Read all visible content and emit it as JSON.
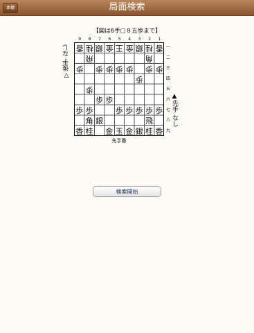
{
  "navbar": {
    "title": "局面検索",
    "back_label": "本棚"
  },
  "board_caption": "【図は6手▢８五歩まで】",
  "file_labels": [
    "9",
    "8",
    "7",
    "6",
    "5",
    "4",
    "3",
    "2",
    "1"
  ],
  "rank_labels": [
    "一",
    "二",
    "三",
    "四",
    "五",
    "六",
    "七",
    "八",
    "九"
  ],
  "gote_hand": "▽後手 なし",
  "sente_hand": "▲先手 なし",
  "turn_label": "先手番",
  "search_button": "検索開始",
  "board": {
    "gote_pieces": [
      {
        "piece": "香",
        "file": 9,
        "rank": 1
      },
      {
        "piece": "桂",
        "file": 8,
        "rank": 1
      },
      {
        "piece": "銀",
        "file": 7,
        "rank": 1
      },
      {
        "piece": "金",
        "file": 6,
        "rank": 1
      },
      {
        "piece": "王",
        "file": 5,
        "rank": 1
      },
      {
        "piece": "金",
        "file": 4,
        "rank": 1
      },
      {
        "piece": "銀",
        "file": 3,
        "rank": 1
      },
      {
        "piece": "桂",
        "file": 2,
        "rank": 1
      },
      {
        "piece": "香",
        "file": 1,
        "rank": 1
      },
      {
        "piece": "飛",
        "file": 8,
        "rank": 2
      },
      {
        "piece": "角",
        "file": 2,
        "rank": 2
      },
      {
        "piece": "歩",
        "file": 9,
        "rank": 3
      },
      {
        "piece": "歩",
        "file": 7,
        "rank": 3
      },
      {
        "piece": "歩",
        "file": 6,
        "rank": 3
      },
      {
        "piece": "歩",
        "file": 5,
        "rank": 3
      },
      {
        "piece": "歩",
        "file": 4,
        "rank": 3
      },
      {
        "piece": "歩",
        "file": 2,
        "rank": 3
      },
      {
        "piece": "歩",
        "file": 1,
        "rank": 3
      },
      {
        "piece": "歩",
        "file": 3,
        "rank": 4
      },
      {
        "piece": "歩",
        "file": 8,
        "rank": 5
      }
    ],
    "sente_pieces": [
      {
        "piece": "歩",
        "file": 7,
        "rank": 6
      },
      {
        "piece": "歩",
        "file": 6,
        "rank": 6
      },
      {
        "piece": "歩",
        "file": 9,
        "rank": 7
      },
      {
        "piece": "歩",
        "file": 8,
        "rank": 7
      },
      {
        "piece": "歩",
        "file": 5,
        "rank": 7
      },
      {
        "piece": "歩",
        "file": 4,
        "rank": 7
      },
      {
        "piece": "歩",
        "file": 3,
        "rank": 7
      },
      {
        "piece": "歩",
        "file": 2,
        "rank": 7
      },
      {
        "piece": "歩",
        "file": 1,
        "rank": 7
      },
      {
        "piece": "角",
        "file": 8,
        "rank": 8
      },
      {
        "piece": "飛",
        "file": 2,
        "rank": 8
      },
      {
        "piece": "銀",
        "file": 7,
        "rank": 8
      },
      {
        "piece": "香",
        "file": 9,
        "rank": 9
      },
      {
        "piece": "桂",
        "file": 8,
        "rank": 9
      },
      {
        "piece": "金",
        "file": 6,
        "rank": 9
      },
      {
        "piece": "玉",
        "file": 5,
        "rank": 9
      },
      {
        "piece": "金",
        "file": 4,
        "rank": 9
      },
      {
        "piece": "銀",
        "file": 3,
        "rank": 9
      },
      {
        "piece": "桂",
        "file": 2,
        "rank": 9
      },
      {
        "piece": "香",
        "file": 1,
        "rank": 9
      }
    ]
  }
}
